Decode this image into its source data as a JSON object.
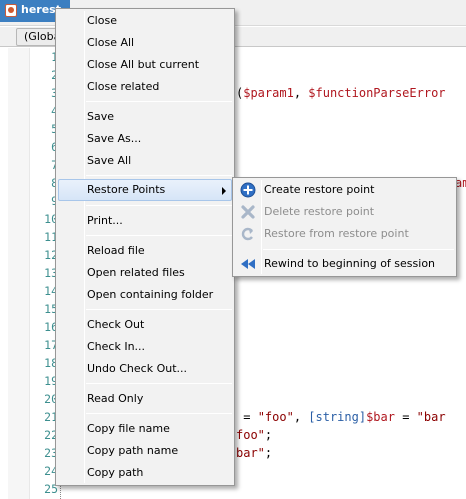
{
  "tab": {
    "title": "herest"
  },
  "scope": {
    "value": "(Globa"
  },
  "editor": {
    "line_numbers": [
      "1",
      "2",
      "3",
      "4",
      "5",
      "6",
      "7",
      "8",
      "9",
      "10",
      "11",
      "12",
      "13",
      "14",
      "15",
      "16",
      "17",
      "18",
      "19",
      "20",
      "21",
      "22",
      "23",
      "24",
      "25"
    ],
    "code": {
      "l3_open": "(",
      "l3_p1": "$param1",
      "l3_sep": ", ",
      "l3_p2": "$functionParseError",
      "l8_frag": "am",
      "l21_eq": " = ",
      "l21_s1": "\"foo\"",
      "l21_comma": ", ",
      "l21_type": "[string]",
      "l21_var": "$bar",
      "l21_eq2": " = ",
      "l21_s2": "\"bar",
      "l22_s": "foo\"",
      "l22_end": ";",
      "l23_s": "bar\"",
      "l23_end": ";"
    }
  },
  "context_menu": {
    "items": [
      "Close",
      "Close All",
      "Close All but current",
      "Close related",
      "Save",
      "Save As...",
      "Save All",
      "Restore Points",
      "Print...",
      "Reload file",
      "Open related files",
      "Open containing folder",
      "Check Out",
      "Check In...",
      "Undo Check Out...",
      "Read Only",
      "Copy file name",
      "Copy path name",
      "Copy path"
    ]
  },
  "submenu": {
    "items": [
      {
        "label": "Create restore point",
        "icon": "add-circle-icon",
        "enabled": true
      },
      {
        "label": "Delete restore point",
        "icon": "delete-x-icon",
        "enabled": false
      },
      {
        "label": "Restore from restore point",
        "icon": "restore-arrow-icon",
        "enabled": false
      },
      {
        "label": "Rewind to beginning of session",
        "icon": "rewind-icon",
        "enabled": true
      }
    ]
  },
  "colors": {
    "tab_active": "#3c7fc1",
    "line_number": "#3d8f8f",
    "variable": "#b0171f",
    "string": "#8b0000",
    "type": "#2b5fa6",
    "menu_highlight": "#d6e5f7",
    "icon_blue": "#2f6fc4"
  }
}
